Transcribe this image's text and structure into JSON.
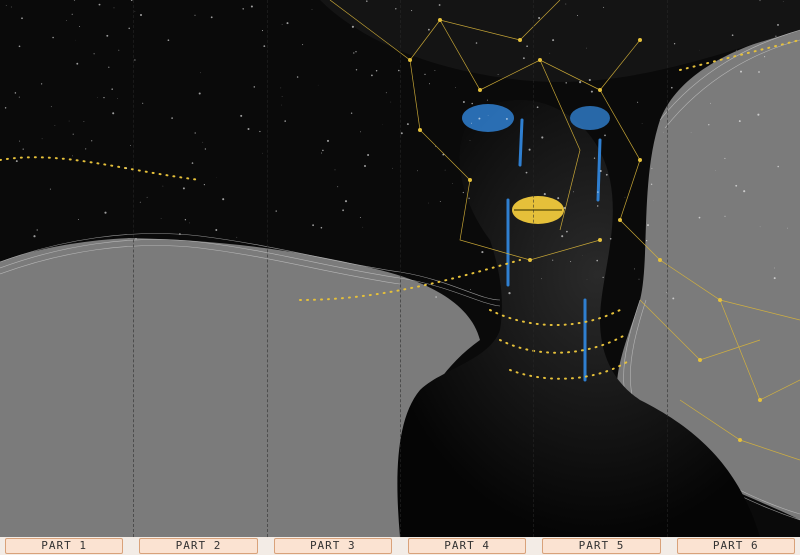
{
  "parts": [
    {
      "label": "PART 1"
    },
    {
      "label": "PART 2"
    },
    {
      "label": "PART 3"
    },
    {
      "label": "PART 4"
    },
    {
      "label": "PART 5"
    },
    {
      "label": "PART 6"
    }
  ],
  "colors": {
    "wall": "#7a7a7a",
    "night": "#0b0b0b",
    "gold": "#e5c03a",
    "blue": "#2f7fd0",
    "line": "#d9d9d9"
  }
}
